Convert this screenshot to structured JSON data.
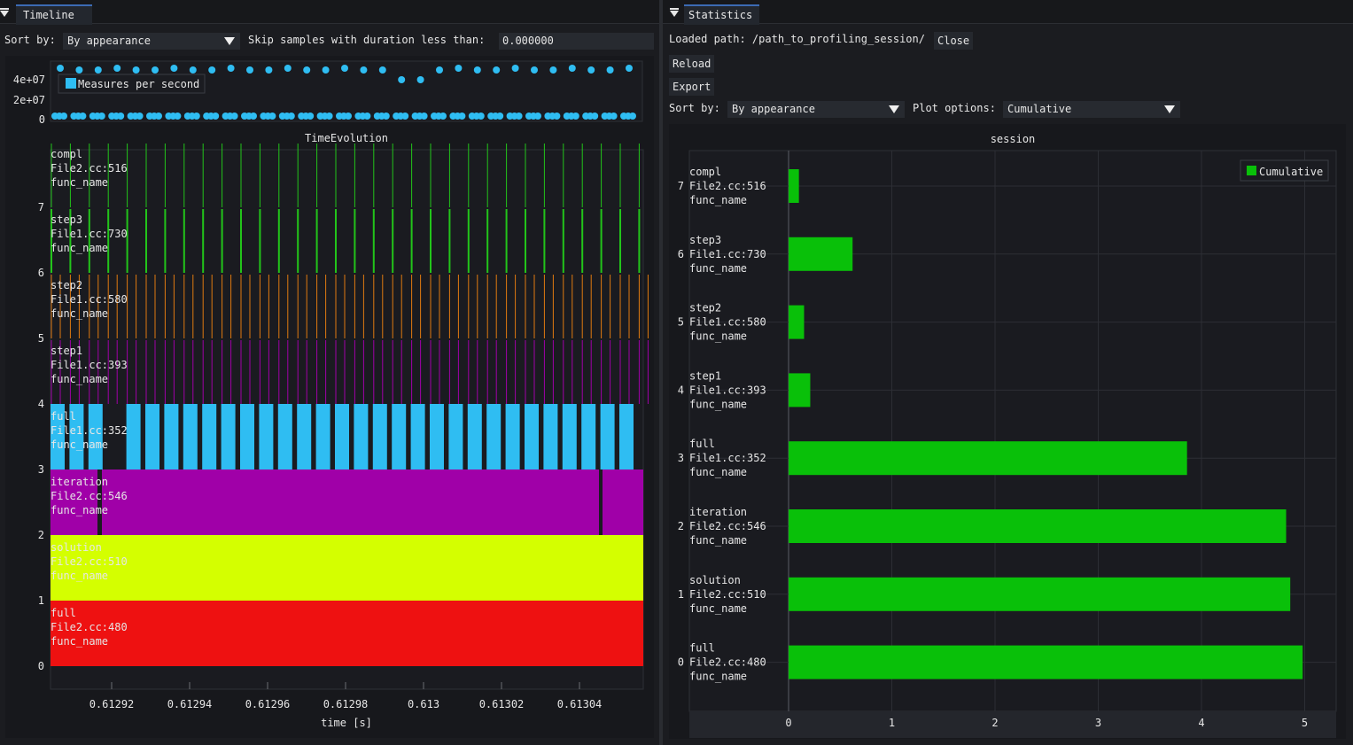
{
  "timeline": {
    "tab_label": "Timeline",
    "sort_label": "Sort by:",
    "sort_value": "By appearance",
    "skip_label": "Skip samples with duration less than:",
    "skip_value": "0.000000"
  },
  "statistics": {
    "tab_label": "Statistics",
    "loaded_path_label": "Loaded path: /path_to_profiling_session/",
    "close_label": "Close",
    "reload_label": "Reload",
    "export_label": "Export",
    "sort_label": "Sort by:",
    "sort_value": "By appearance",
    "plot_options_label": "Plot options:",
    "plot_options_value": "Cumulative"
  },
  "chart_data": [
    {
      "type": "scatter",
      "title": "",
      "legend": [
        "Measures per second"
      ],
      "legend_placement": "top-left",
      "y_ticks": [
        "0",
        "2e+07",
        "4e+07"
      ],
      "series": [
        {
          "name": "Measures per second",
          "color": "#2fbdf2"
        }
      ]
    },
    {
      "type": "timeline",
      "title": "TimeEvolution",
      "xlabel": "time [s]",
      "x_ticks": [
        "0.61292",
        "0.61294",
        "0.61296",
        "0.61298",
        "0.613",
        "0.61302",
        "0.61304"
      ],
      "y_ticks": [
        "0",
        "1",
        "2",
        "3",
        "4",
        "5",
        "6",
        "7"
      ],
      "rows": [
        {
          "index": 0,
          "lines": [
            "full",
            "File2.cc:480",
            "func_name"
          ],
          "color": "#ee1111"
        },
        {
          "index": 1,
          "lines": [
            "solution",
            "File2.cc:510",
            "func_name"
          ],
          "color": "#d4ff00"
        },
        {
          "index": 2,
          "lines": [
            "iteration",
            "File2.cc:546",
            "func_name"
          ],
          "color": "#a000a8"
        },
        {
          "index": 3,
          "lines": [
            "full",
            "File1.cc:352",
            "func_name"
          ],
          "color": "#2fbdf2"
        },
        {
          "index": 4,
          "lines": [
            "step1",
            "File1.cc:393",
            "func_name"
          ],
          "color": "#a000a8"
        },
        {
          "index": 5,
          "lines": [
            "step2",
            "File1.cc:580",
            "func_name"
          ],
          "color": "#e07a10"
        },
        {
          "index": 6,
          "lines": [
            "step3",
            "File1.cc:730",
            "func_name"
          ],
          "color": "#22c41a"
        },
        {
          "index": 7,
          "lines": [
            "compl",
            "File2.cc:516",
            "func_name"
          ],
          "color": "#22c41a"
        }
      ]
    },
    {
      "type": "bar",
      "orientation": "horizontal",
      "title": "session",
      "legend": [
        "Cumulative"
      ],
      "legend_placement": "top-right",
      "xlim": [
        0,
        5.3
      ],
      "x_ticks": [
        "0",
        "1",
        "2",
        "3",
        "4",
        "5"
      ],
      "grid": true,
      "bar_color": "#09c009",
      "categories": [
        {
          "index": "0",
          "lines": [
            "full",
            "File2.cc:480",
            "func_name"
          ]
        },
        {
          "index": "1",
          "lines": [
            "solution",
            "File2.cc:510",
            "func_name"
          ]
        },
        {
          "index": "2",
          "lines": [
            "iteration",
            "File2.cc:546",
            "func_name"
          ]
        },
        {
          "index": "3",
          "lines": [
            "full",
            "File1.cc:352",
            "func_name"
          ]
        },
        {
          "index": "4",
          "lines": [
            "step1",
            "File1.cc:393",
            "func_name"
          ]
        },
        {
          "index": "5",
          "lines": [
            "step2",
            "File1.cc:580",
            "func_name"
          ]
        },
        {
          "index": "6",
          "lines": [
            "step3",
            "File1.cc:730",
            "func_name"
          ]
        },
        {
          "index": "7",
          "lines": [
            "compl",
            "File2.cc:516",
            "func_name"
          ]
        }
      ],
      "values": [
        4.98,
        4.86,
        4.82,
        3.86,
        0.21,
        0.15,
        0.62,
        0.1
      ]
    }
  ]
}
